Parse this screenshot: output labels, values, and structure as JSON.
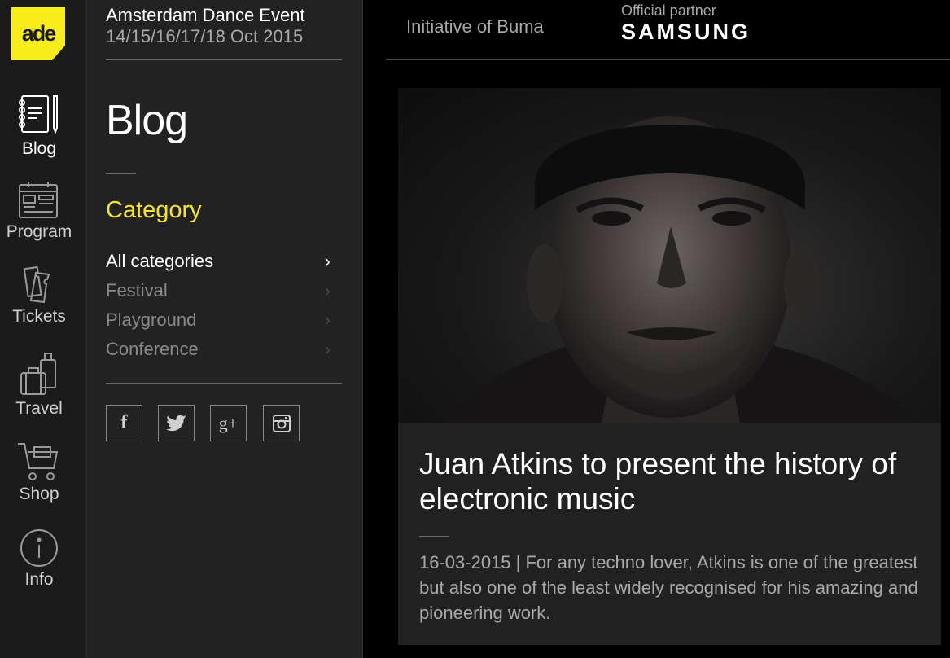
{
  "logo": {
    "text": "ade"
  },
  "rail": {
    "items": [
      {
        "label": "Blog",
        "icon": "blog-icon"
      },
      {
        "label": "Program",
        "icon": "program-icon"
      },
      {
        "label": "Tickets",
        "icon": "tickets-icon"
      },
      {
        "label": "Travel",
        "icon": "travel-icon"
      },
      {
        "label": "Shop",
        "icon": "shop-icon"
      },
      {
        "label": "Info",
        "icon": "info-icon"
      }
    ]
  },
  "event": {
    "title": "Amsterdam Dance Event",
    "dates": "14/15/16/17/18 Oct 2015"
  },
  "section": {
    "title": "Blog"
  },
  "category": {
    "heading": "Category",
    "items": [
      {
        "label": "All categories"
      },
      {
        "label": "Festival"
      },
      {
        "label": "Playground"
      },
      {
        "label": "Conference"
      }
    ]
  },
  "social": {
    "facebook": "f",
    "twitter": "twitter-icon",
    "googleplus": "g+",
    "instagram": "instagram-icon"
  },
  "topbar": {
    "initiative": "Initiative of Buma",
    "partner_label": "Official partner",
    "partner_brand": "SAMSUNG"
  },
  "article": {
    "headline": "Juan Atkins to present the history of electronic music",
    "excerpt": "16-03-2015 | For any techno lover, Atkins is one of the greatest but also one of the least widely recognised for his amazing and pioneering work."
  },
  "colors": {
    "accent": "#f7ed1d",
    "rail_bg": "#1c1b1c",
    "col2_bg": "#232223",
    "card_bg": "#222122"
  }
}
